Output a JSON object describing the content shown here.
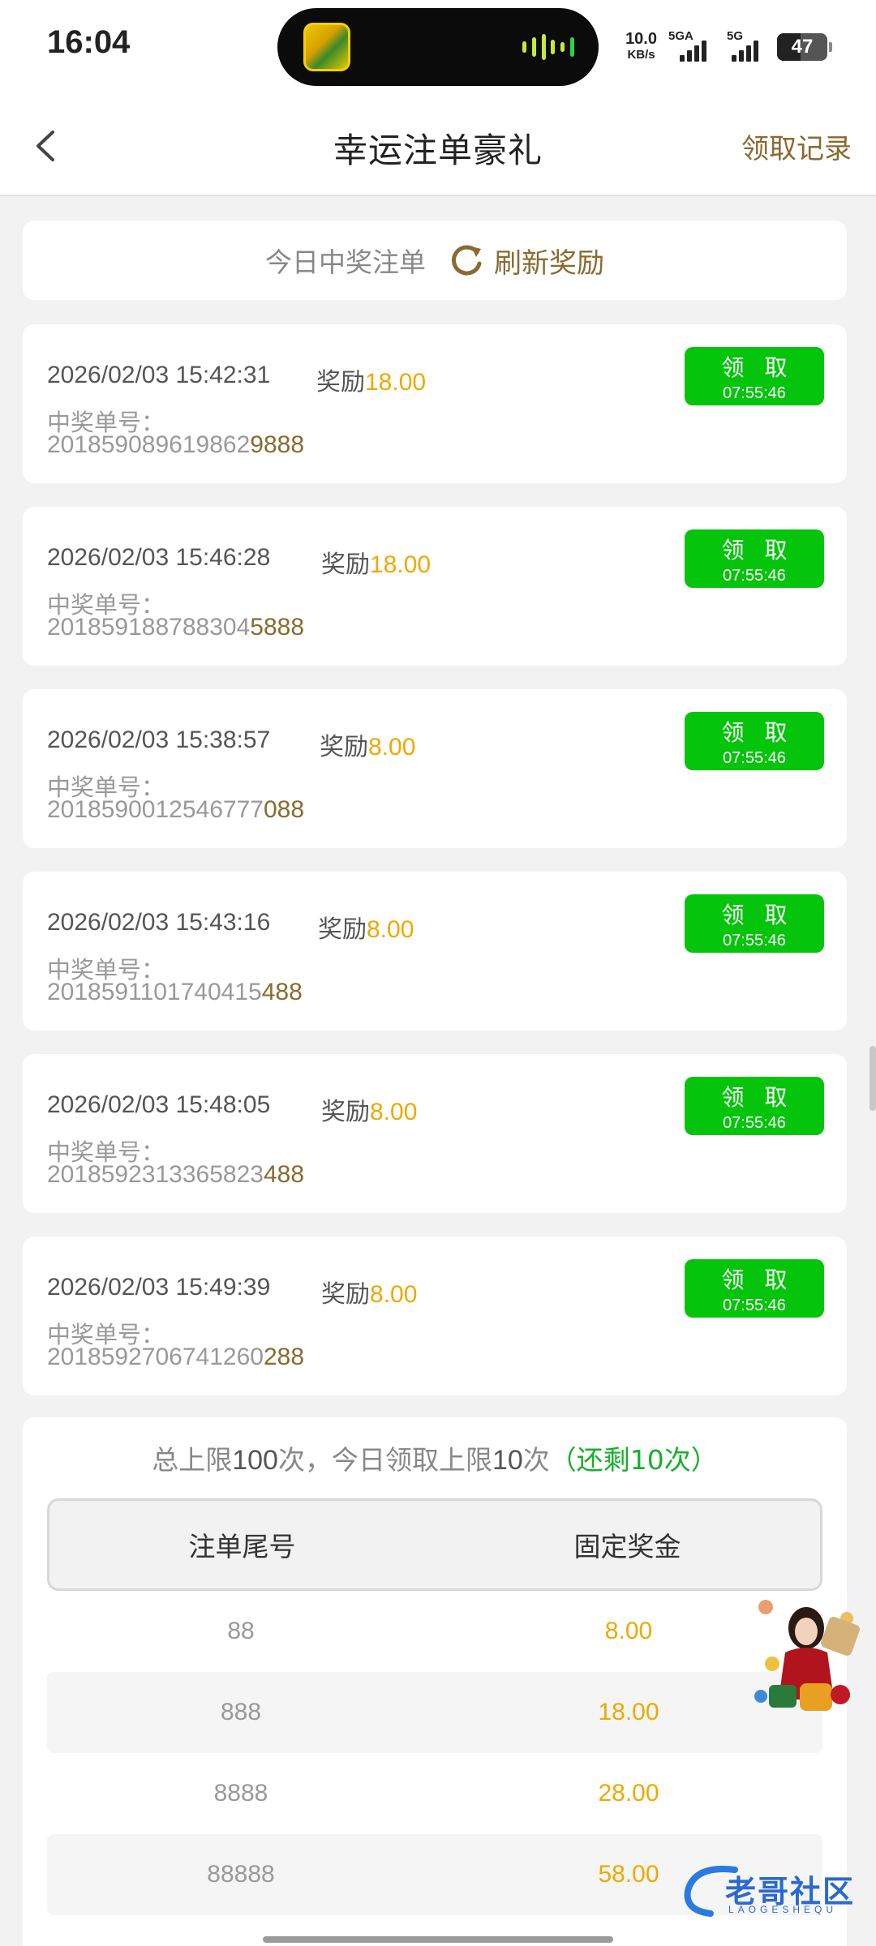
{
  "status_bar": {
    "time": "16:04",
    "net_speed": "10.0",
    "net_unit": "KB/s",
    "sim1": "5GA",
    "sim2": "5G",
    "battery": "47",
    "battery_level": 0.47
  },
  "header": {
    "back_icon": "chevron-left-icon",
    "title": "幸运注单豪礼",
    "right_link": "领取记录"
  },
  "today": {
    "label": "今日中奖注单",
    "refresh_icon": "refresh-icon",
    "refresh_label": "刷新奖励"
  },
  "colors": {
    "claim_green": "#05c40c",
    "amount_orange": "#f0a800",
    "brown_accent": "#8a6a30",
    "remaining_green": "#17b02a"
  },
  "tickets": [
    {
      "date": "2026/02/03 15:42:31",
      "reward_label": "奖励",
      "amount": "18.00",
      "number_label": "中奖单号：",
      "number_head": "201859089619862",
      "number_tail": "9888",
      "claim_label": "领 取",
      "claim_timer": "07:55:46"
    },
    {
      "date": "2026/02/03 15:46:28",
      "reward_label": "奖励",
      "amount": "18.00",
      "number_label": "中奖单号：",
      "number_head": "201859188788304",
      "number_tail": "5888",
      "claim_label": "领 取",
      "claim_timer": "07:55:46"
    },
    {
      "date": "2026/02/03 15:38:57",
      "reward_label": "奖励",
      "amount": "8.00",
      "number_label": "中奖单号：",
      "number_head": "2018590012546777",
      "number_tail": "088",
      "claim_label": "领 取",
      "claim_timer": "07:55:46"
    },
    {
      "date": "2026/02/03 15:43:16",
      "reward_label": "奖励",
      "amount": "8.00",
      "number_label": "中奖单号：",
      "number_head": "2018591101740415",
      "number_tail": "488",
      "claim_label": "领 取",
      "claim_timer": "07:55:46"
    },
    {
      "date": "2026/02/03 15:48:05",
      "reward_label": "奖励",
      "amount": "8.00",
      "number_label": "中奖单号：",
      "number_head": "2018592313365823",
      "number_tail": "488",
      "claim_label": "领 取",
      "claim_timer": "07:55:46"
    },
    {
      "date": "2026/02/03 15:49:39",
      "reward_label": "奖励",
      "amount": "8.00",
      "number_label": "中奖单号：",
      "number_head": "2018592706741260",
      "number_tail": "288",
      "claim_label": "领 取",
      "claim_timer": "07:55:46"
    }
  ],
  "limits": {
    "total_prefix": "总上限",
    "total_count": "100",
    "total_suffix": "次，今日领取上限",
    "daily_count": "10",
    "daily_suffix": "次",
    "remaining": "（还剩10次）"
  },
  "prize_table": {
    "headers": [
      "注单尾号",
      "固定奖金"
    ],
    "rows": [
      {
        "tail": "88",
        "prize": "8.00"
      },
      {
        "tail": "888",
        "prize": "18.00"
      },
      {
        "tail": "8888",
        "prize": "28.00"
      },
      {
        "tail": "88888",
        "prize": "58.00"
      }
    ]
  },
  "floating": {
    "promo_icon": "promo-avatar-icon",
    "watermark_text": "老哥社区",
    "watermark_sub": "LAOGESHEQU"
  }
}
